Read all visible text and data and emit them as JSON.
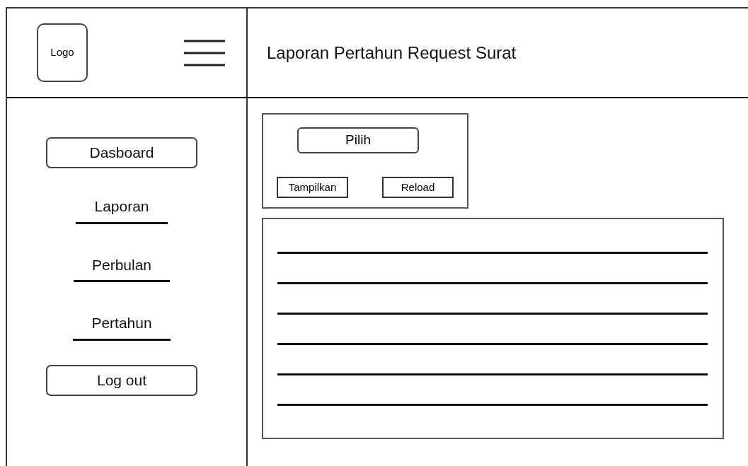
{
  "header": {
    "logo": "Logo",
    "title": "Laporan Pertahun Request Surat"
  },
  "sidebar": {
    "items": [
      {
        "label": "Dasboard",
        "kind": "button"
      },
      {
        "label": "Laporan",
        "kind": "link"
      },
      {
        "label": "Perbulan",
        "kind": "link"
      },
      {
        "label": "Pertahun",
        "kind": "link"
      },
      {
        "label": "Log out",
        "kind": "button"
      }
    ]
  },
  "filter": {
    "select": "Pilih",
    "buttons": [
      "Tampilkan",
      "Reload"
    ]
  }
}
